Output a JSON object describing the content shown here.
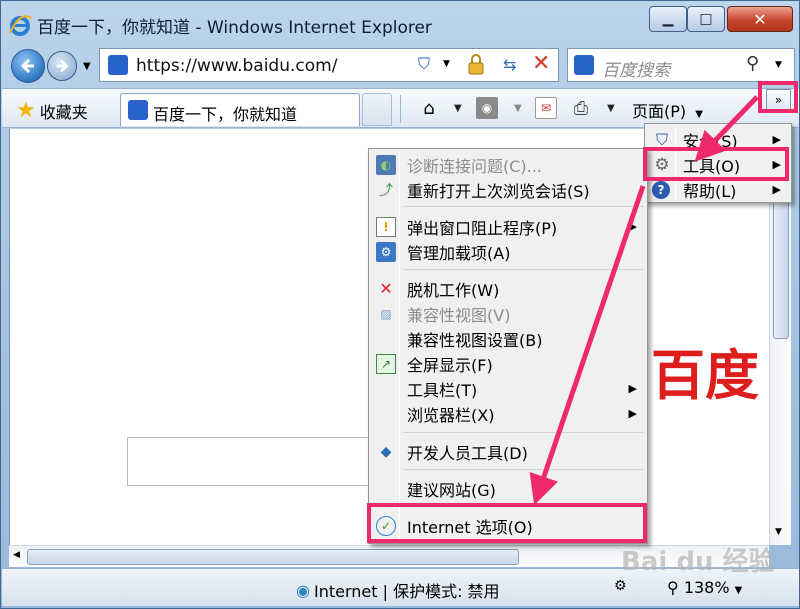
{
  "window": {
    "title": "百度一下，你就知道 - Windows Internet Explorer",
    "min_symbol": "▁",
    "max_symbol": "□",
    "close_symbol": "✕"
  },
  "nav": {
    "address": "https://www.baidu.com/",
    "search_placeholder": "百度搜索",
    "search_icon": "magnifier-icon"
  },
  "commandbar": {
    "favorites_label": "收藏夹",
    "tab_title": "百度一下，你就知道",
    "page_label": "页面(P)",
    "overflow_label": "»"
  },
  "content": {
    "logo_text": "百度"
  },
  "status": {
    "zone": "Internet | 保护模式: 禁用",
    "zoom": "138%"
  },
  "watermark": "Bai du 经验",
  "overflow_menu": {
    "items": [
      {
        "label": "安全(S)",
        "icon": "shield-icon",
        "submenu": true
      },
      {
        "label": "工具(O)",
        "icon": "gear-icon",
        "submenu": true
      },
      {
        "label": "帮助(L)",
        "icon": "help-icon",
        "submenu": true
      }
    ]
  },
  "tools_menu": {
    "items": [
      {
        "label": "诊断连接问题(C)...",
        "icon": "diagnose-icon",
        "disabled": true
      },
      {
        "label": "重新打开上次浏览会话(S)",
        "icon": "reopen-icon",
        "disabled": false
      },
      {
        "label": "弹出窗口阻止程序(P)",
        "icon": "popup-blocker-icon",
        "submenu": true
      },
      {
        "label": "管理加载项(A)",
        "icon": "addons-icon"
      },
      {
        "label": "脱机工作(W)",
        "icon": "offline-icon"
      },
      {
        "label": "兼容性视图(V)",
        "icon": "compat-view-icon",
        "disabled": true
      },
      {
        "label": "兼容性视图设置(B)"
      },
      {
        "label": "全屏显示(F)",
        "icon": "fullscreen-icon"
      },
      {
        "label": "工具栏(T)",
        "submenu": true
      },
      {
        "label": "浏览器栏(X)",
        "submenu": true
      },
      {
        "label": "开发人员工具(D)",
        "icon": "devtools-icon"
      },
      {
        "label": "建议网站(G)"
      },
      {
        "label": "Internet 选项(O)",
        "icon": "internet-options-icon"
      }
    ]
  },
  "colors": {
    "highlight": "#ee2a6c",
    "baidu_red": "#de1d1d"
  }
}
